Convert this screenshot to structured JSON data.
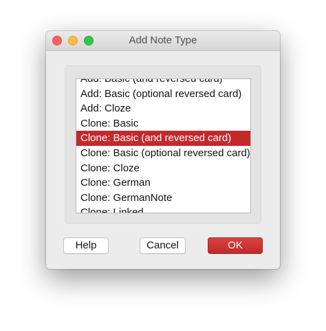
{
  "window": {
    "title": "Add Note Type"
  },
  "list": {
    "items": [
      "Add: Basic (and reversed card)",
      "Add: Basic (optional reversed card)",
      "Add: Cloze",
      "Clone: Basic",
      "Clone: Basic (and reversed card)",
      "Clone: Basic (optional reversed card)",
      "Clone: Cloze",
      "Clone: German",
      "Clone: GermanNote",
      "Clone: Linked"
    ],
    "selected_index": 4
  },
  "buttons": {
    "help": "Help",
    "cancel": "Cancel",
    "ok": "OK"
  },
  "colors": {
    "selection": "#c4292a",
    "primary_button": "#c9302c",
    "close": "#fc605c",
    "minimize": "#fdbc40",
    "zoom": "#34c84a"
  }
}
